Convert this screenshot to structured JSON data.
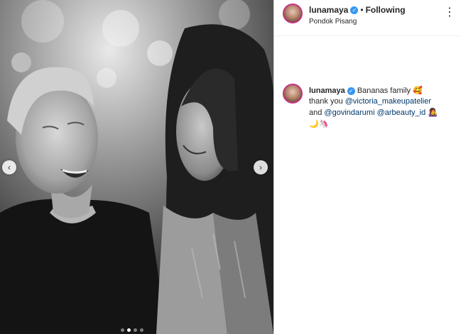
{
  "post": {
    "username": "lunamaya",
    "separator": "•",
    "follow_status": "Following",
    "location": "Pondok Pisang",
    "more_icon": "more-options-icon",
    "verified_icon": "verified-badge-icon"
  },
  "caption": {
    "username": "lunamaya",
    "text_1": "Bananas family",
    "emoji_1": "🥰",
    "text_2": "thank you",
    "mention_1": "@victoria_makeupatelier",
    "text_3": "and",
    "mention_2": "@govindarumi",
    "mention_3": "@arbeauty_id",
    "emoji_2": "👩‍🎤",
    "emoji_3": "🌙",
    "emoji_4": "🦄"
  },
  "carousel": {
    "prev_icon": "‹",
    "next_icon": "›",
    "slide_count": 4,
    "active_slide": 2
  },
  "colors": {
    "verified": "#3897f0",
    "mention": "#00376b",
    "story_ring": "#c13584"
  }
}
